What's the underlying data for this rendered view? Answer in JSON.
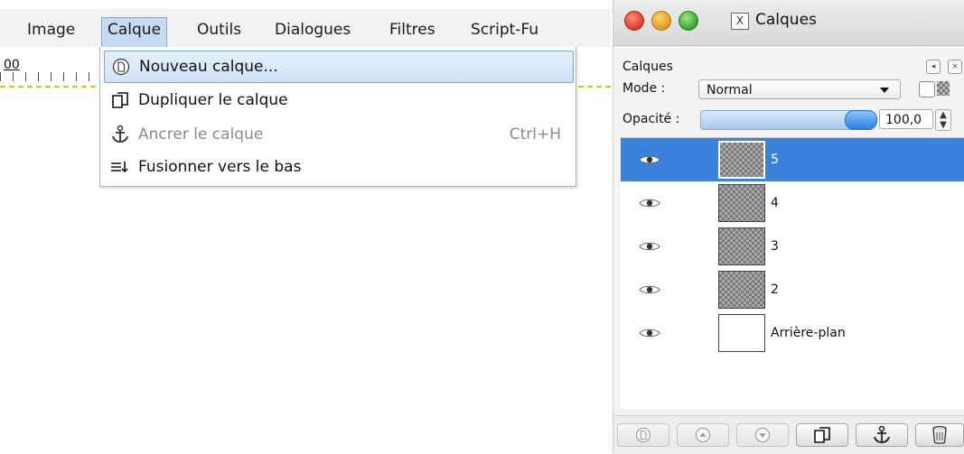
{
  "menubar": {
    "items": [
      {
        "label": "Image"
      },
      {
        "label": "Calque"
      },
      {
        "label": "Outils"
      },
      {
        "label": "Dialogues"
      },
      {
        "label": "Filtres"
      },
      {
        "label": "Script-Fu"
      }
    ],
    "active_index": 1
  },
  "ruler": {
    "start_label": "00"
  },
  "calque_menu": {
    "items": [
      {
        "label": "Nouveau calque...",
        "icon": "new-layer-icon",
        "highlighted": true
      },
      {
        "label": "Dupliquer le calque",
        "icon": "duplicate-layer-icon"
      },
      {
        "label": "Ancrer le calque",
        "icon": "anchor-icon",
        "shortcut": "Ctrl+H",
        "disabled": true
      },
      {
        "label": "Fusionner vers le bas",
        "icon": "merge-down-icon"
      }
    ]
  },
  "layers_panel": {
    "window_title": "Calques",
    "section_label": "Calques",
    "mode_label": "Mode :",
    "mode_value": "Normal",
    "opacity_label": "Opacité :",
    "opacity_value": "100,0",
    "opacity_fraction": 1.0,
    "layers": [
      {
        "name": "5",
        "thumbnail": "checker",
        "selected": true
      },
      {
        "name": "4",
        "thumbnail": "checker"
      },
      {
        "name": "3",
        "thumbnail": "checker"
      },
      {
        "name": "2",
        "thumbnail": "checker"
      },
      {
        "name": "Arrière-plan",
        "thumbnail": "white"
      }
    ],
    "bottom_buttons": [
      {
        "icon": "new-layer-icon",
        "disabled": true
      },
      {
        "icon": "raise-layer-icon",
        "disabled": true
      },
      {
        "icon": "lower-layer-icon",
        "disabled": true
      },
      {
        "icon": "duplicate-layer-icon"
      },
      {
        "icon": "anchor-icon"
      },
      {
        "icon": "delete-icon"
      }
    ]
  },
  "colors": {
    "selection": "#3b82dc",
    "menu_highlight": "#cfe1f6",
    "guide": "#e1c400"
  }
}
